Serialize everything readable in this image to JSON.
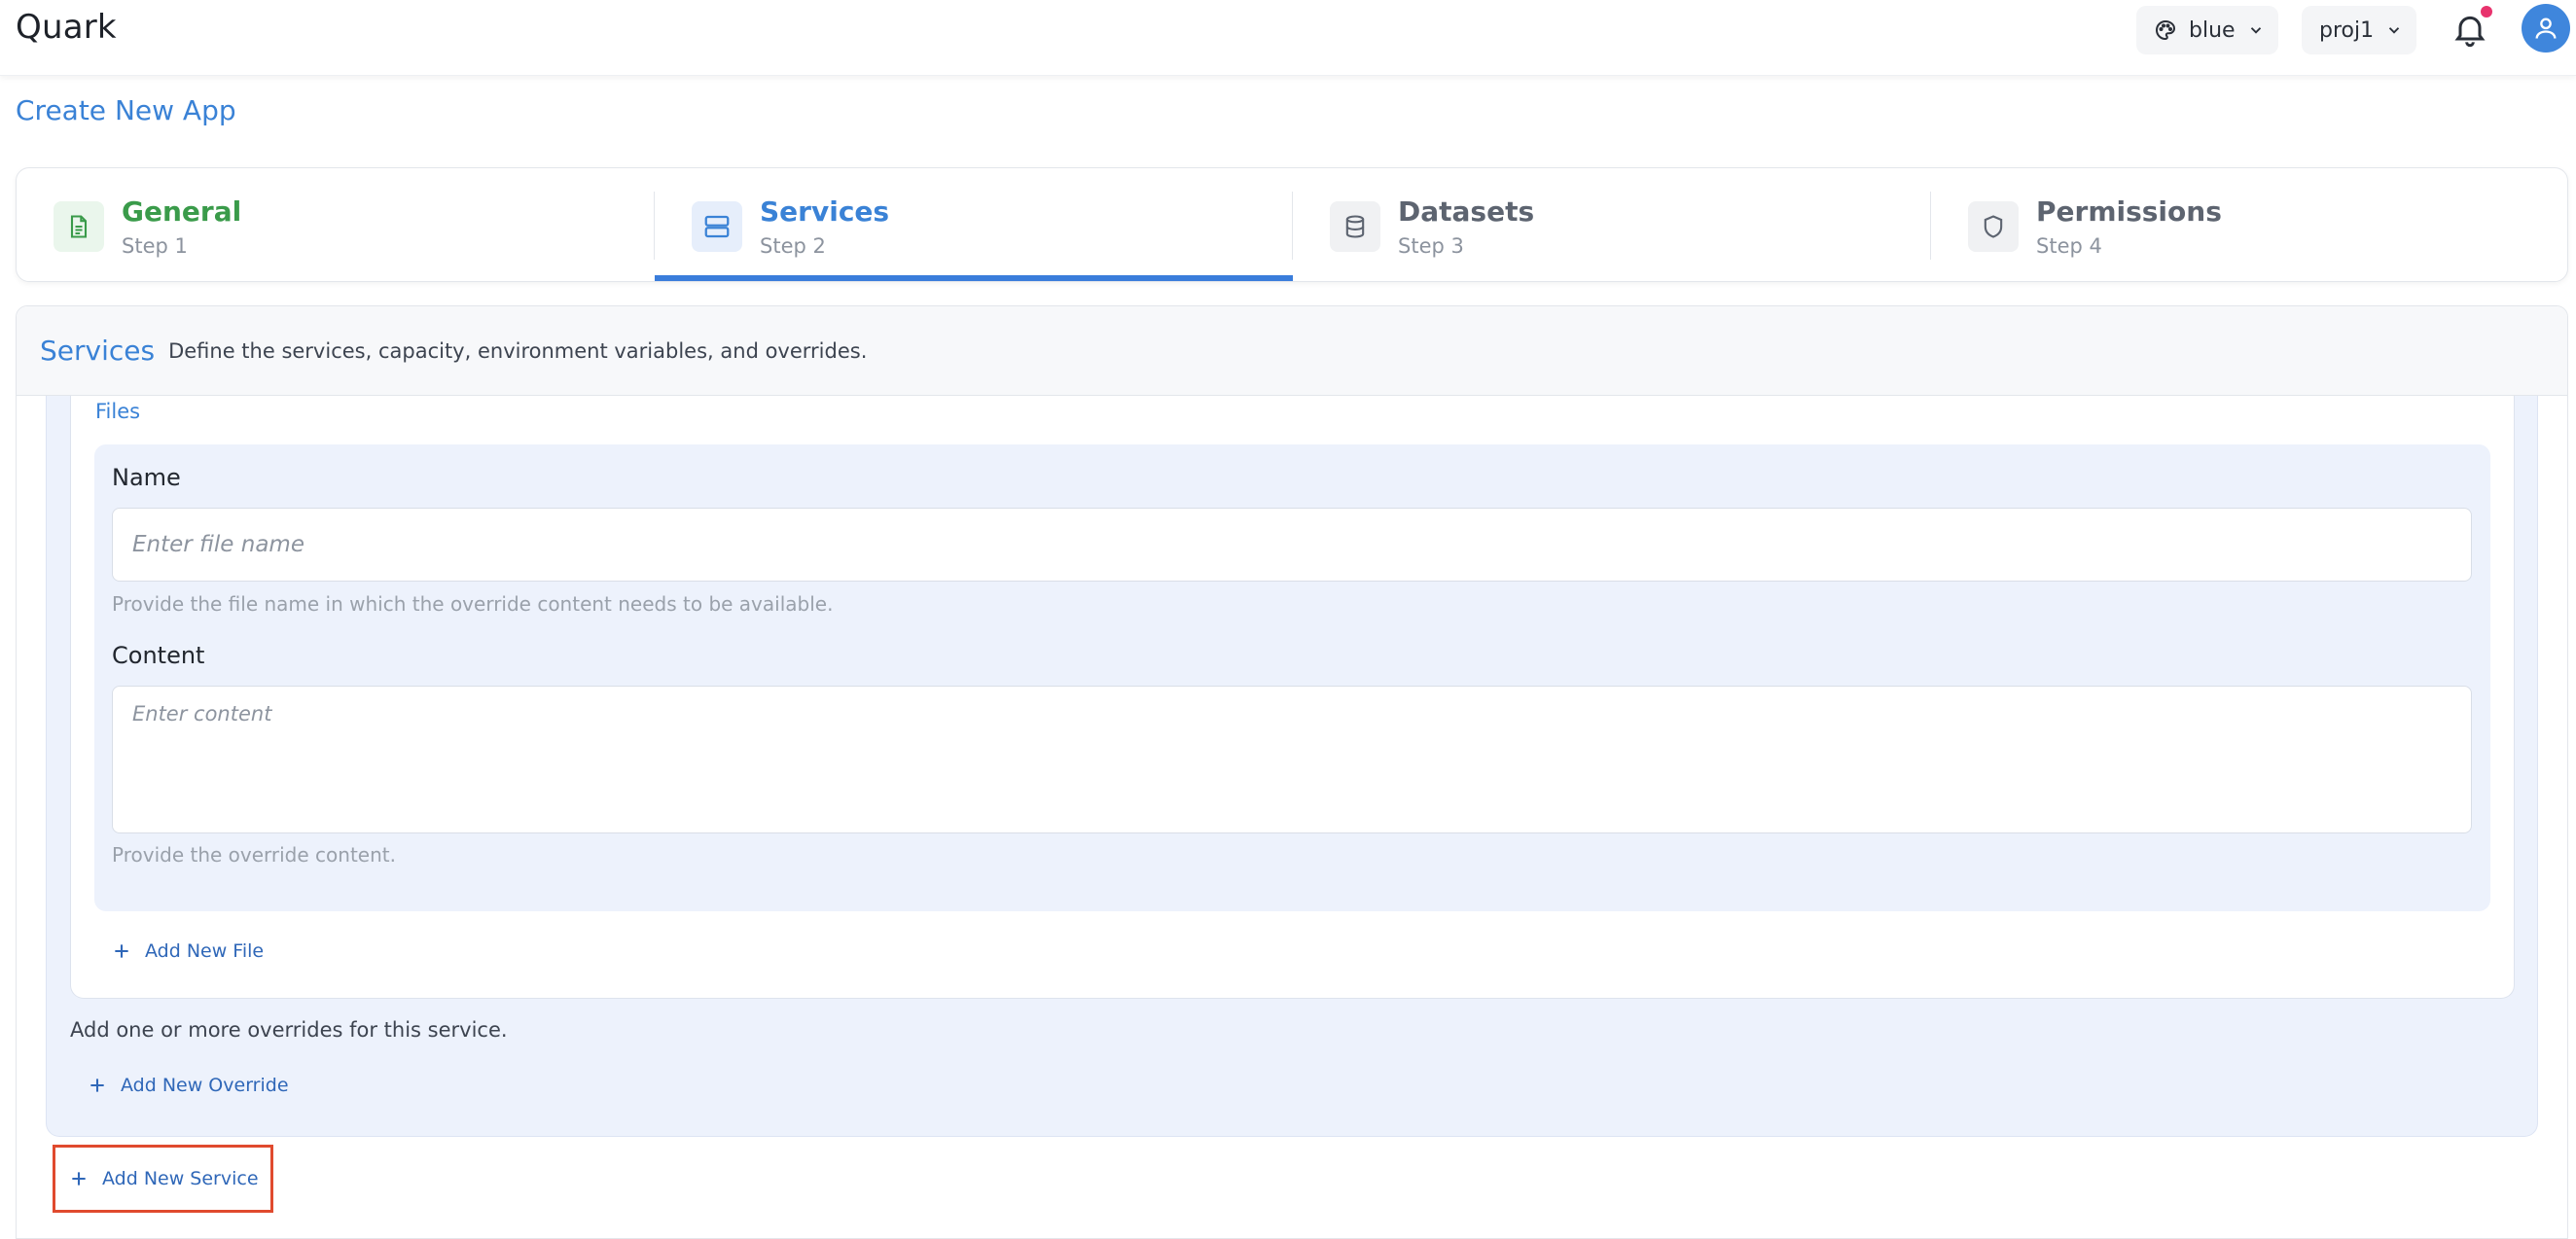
{
  "header": {
    "brand": "Quark",
    "theme_selector": {
      "value": "blue"
    },
    "project_selector": {
      "value": "proj1"
    },
    "notifications": {
      "has_unread": true
    },
    "accent_color": "#3f86dc"
  },
  "page": {
    "title": "Create New App"
  },
  "stepper": {
    "steps": [
      {
        "title": "General",
        "subtitle": "Step 1",
        "icon": "document-icon",
        "state": "complete",
        "color": "#3a9b4a"
      },
      {
        "title": "Services",
        "subtitle": "Step 2",
        "icon": "server-icon",
        "state": "active",
        "color": "#3a82d6"
      },
      {
        "title": "Datasets",
        "subtitle": "Step 3",
        "icon": "database-icon",
        "state": "pending",
        "color": "#5d6470"
      },
      {
        "title": "Permissions",
        "subtitle": "Step 4",
        "icon": "shield-icon",
        "state": "pending",
        "color": "#5d6470"
      }
    ]
  },
  "services_section": {
    "heading": "Services",
    "description": "Define the services, capacity, environment variables, and overrides.",
    "files": {
      "label": "Files",
      "name_field": {
        "label": "Name",
        "value": "",
        "placeholder": "Enter file name",
        "hint": "Provide the file name in which the override content needs to be available."
      },
      "content_field": {
        "label": "Content",
        "value": "",
        "placeholder": "Enter content",
        "hint": "Provide the override content."
      },
      "add_file_label": "Add New File"
    },
    "overrides_note": "Add one or more overrides for this service.",
    "add_override_label": "Add New Override",
    "add_service_label": "Add New Service"
  }
}
